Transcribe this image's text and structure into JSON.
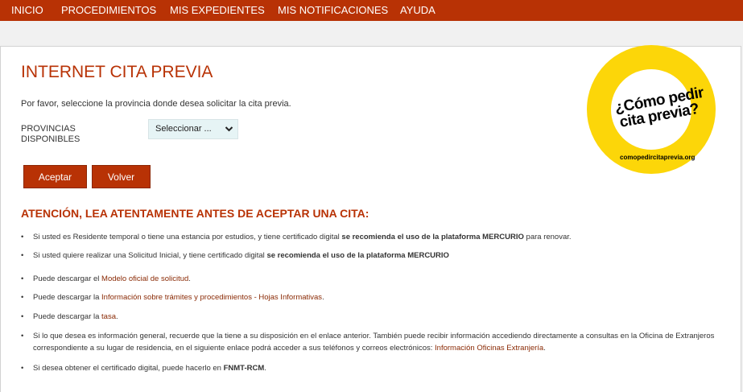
{
  "nav": {
    "items": [
      "INICIO",
      "PROCEDIMIENTOS",
      "MIS EXPEDIENTES",
      "MIS NOTIFICACIONES",
      "AYUDA"
    ]
  },
  "page": {
    "title": "INTERNET CITA PREVIA",
    "intro": "Por favor, seleccione la provincia donde desea solicitar la cita previa.",
    "provinces_label": "PROVINCIAS DISPONIBLES",
    "province_select_value": "Seleccionar ...",
    "accept_button": "Aceptar",
    "back_button": "Volver"
  },
  "logo": {
    "line1": "¿Cómo pedir",
    "line2": "cita previa?",
    "url": "comopedircitaprevia.org",
    "colors": {
      "ring": "#fcd609",
      "center": "#ffffff"
    }
  },
  "notice": {
    "heading": "ATENCIÓN, LEA ATENTAMENTE ANTES DE ACEPTAR UNA CITA:",
    "bullet_glyph": "•",
    "b1": {
      "pre": "Si usted es Residente temporal o tiene una estancia por estudios, y tiene certificado digital ",
      "strong": "se recomienda el uso de la plataforma ",
      "link": "MERCURIO",
      "post": " para renovar."
    },
    "b2": {
      "pre": "Si usted quiere realizar una Solicitud Inicial, y tiene certificado digital ",
      "strong": "se recomienda el uso de la plataforma ",
      "link": "MERCURIO"
    },
    "b3": {
      "pre": "Puede descargar el ",
      "link": "Modelo oficial de solicitud",
      "post": "."
    },
    "b4": {
      "pre": "Puede descargar la ",
      "link": "Información sobre trámites y procedimientos - Hojas Informativas",
      "post": "."
    },
    "b5": {
      "pre": "Puede descargar la ",
      "link": "tasa",
      "post": "."
    },
    "b6": {
      "pre": "Si lo que desea es información general, recuerde que la tiene a su disposición en el enlace anterior. También puede recibir información accediendo directamente a consultas en la Oficina de Extranjeros correspondiente a su lugar de residencia, en el siguiente enlace podrá acceder a sus teléfonos y correos electrónicos: ",
      "link": "Información Oficinas Extranjería",
      "post": "."
    },
    "b7": {
      "pre": "Si desea obtener el certificado digital, puede hacerlo en ",
      "link": "FNMT-RCM",
      "post": "."
    }
  },
  "colors": {
    "brand": "#b83205",
    "link": "#8a2a05",
    "select_bg": "#e6f4f5"
  }
}
